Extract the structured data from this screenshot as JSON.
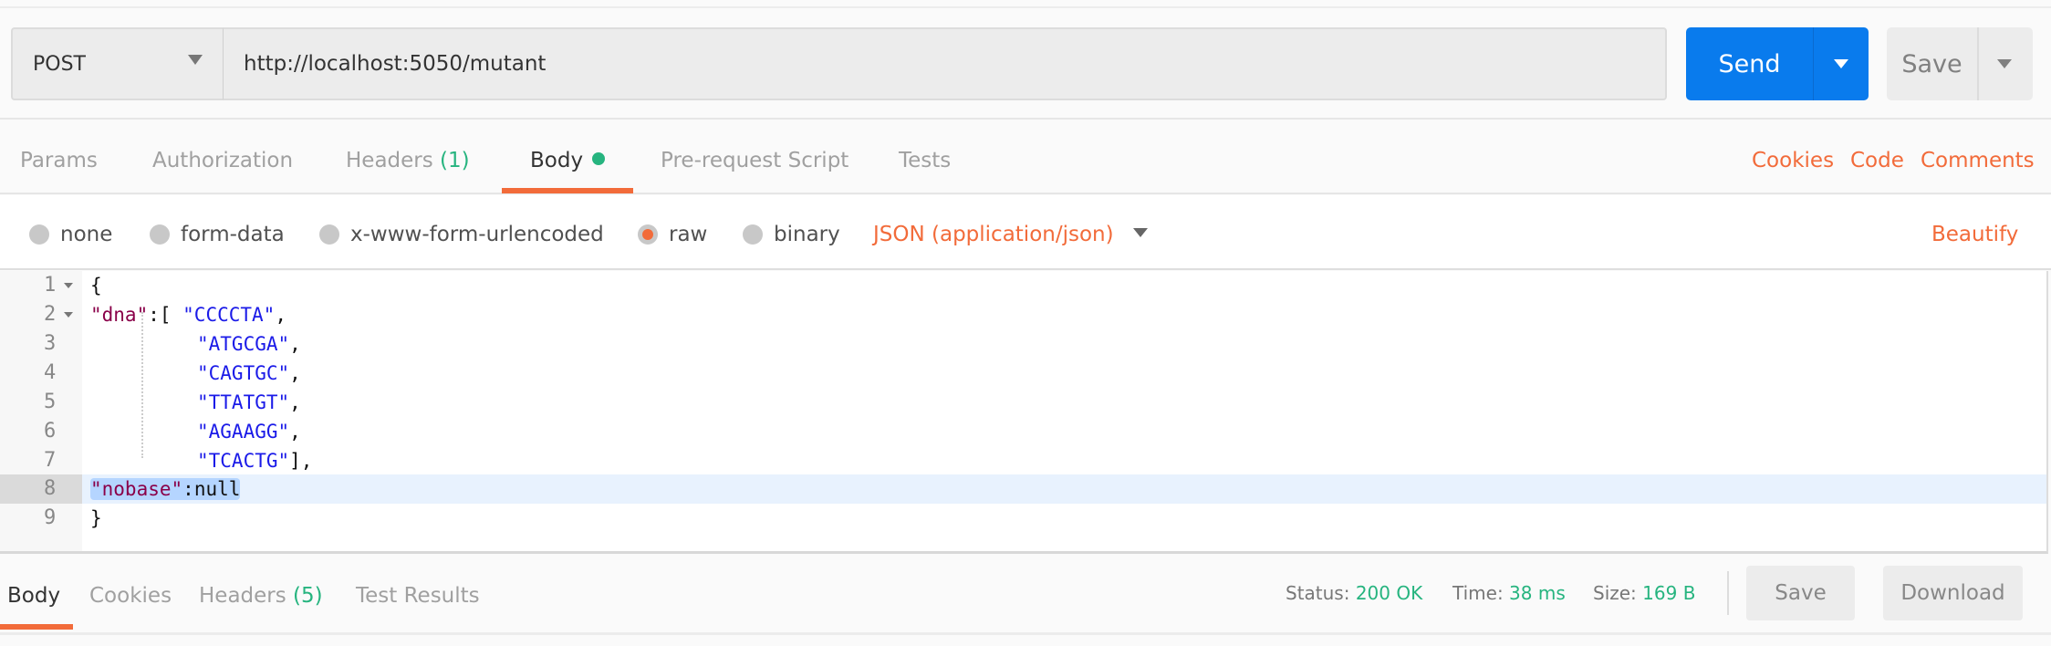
{
  "request": {
    "method": "POST",
    "url": "http://localhost:5050/mutant",
    "send_label": "Send",
    "save_label": "Save"
  },
  "tabs": [
    {
      "label": "Params"
    },
    {
      "label": "Authorization"
    },
    {
      "label": "Headers",
      "count": "(1)"
    },
    {
      "label": "Body",
      "active": true
    },
    {
      "label": "Pre-request Script"
    },
    {
      "label": "Tests"
    }
  ],
  "links": {
    "cookies": "Cookies",
    "code": "Code",
    "comments": "Comments",
    "beautify": "Beautify"
  },
  "body_types": [
    {
      "label": "none"
    },
    {
      "label": "form-data"
    },
    {
      "label": "x-www-form-urlencoded"
    },
    {
      "label": "raw",
      "selected": true
    },
    {
      "label": "binary"
    }
  ],
  "content_type": "JSON (application/json)",
  "editor": {
    "line_numbers": [
      "1",
      "2",
      "3",
      "4",
      "5",
      "6",
      "7",
      "8",
      "9"
    ],
    "current_line": 8,
    "lines": {
      "l1": "{",
      "l2_key": "\"dna\"",
      "l2_punct": ":[ ",
      "l2_val": "\"CCCCTA\"",
      "l2_end": ",",
      "l3_val": "\"ATGCGA\"",
      "l3_end": ",",
      "l4_val": "\"CAGTGC\"",
      "l4_end": ",",
      "l5_val": "\"TTATGT\"",
      "l5_end": ",",
      "l6_val": "\"AGAAGG\"",
      "l6_end": ",",
      "l7_val": "\"TCACTG\"",
      "l7_end": "],",
      "l8_key": "\"nobase\"",
      "l8_punct": ":",
      "l8_val": "null",
      "l9": "}"
    }
  },
  "response": {
    "tabs": [
      {
        "label": "Body",
        "active": true
      },
      {
        "label": "Cookies"
      },
      {
        "label": "Headers",
        "count": "(5)"
      },
      {
        "label": "Test Results"
      }
    ],
    "status_label": "Status:",
    "status": "200 OK",
    "time_label": "Time:",
    "time": "38 ms",
    "size_label": "Size:",
    "size": "169 B",
    "save_label": "Save",
    "download_label": "Download"
  },
  "colors": {
    "accent": "#f26b3a",
    "send": "#097bed",
    "success": "#26b47f"
  }
}
